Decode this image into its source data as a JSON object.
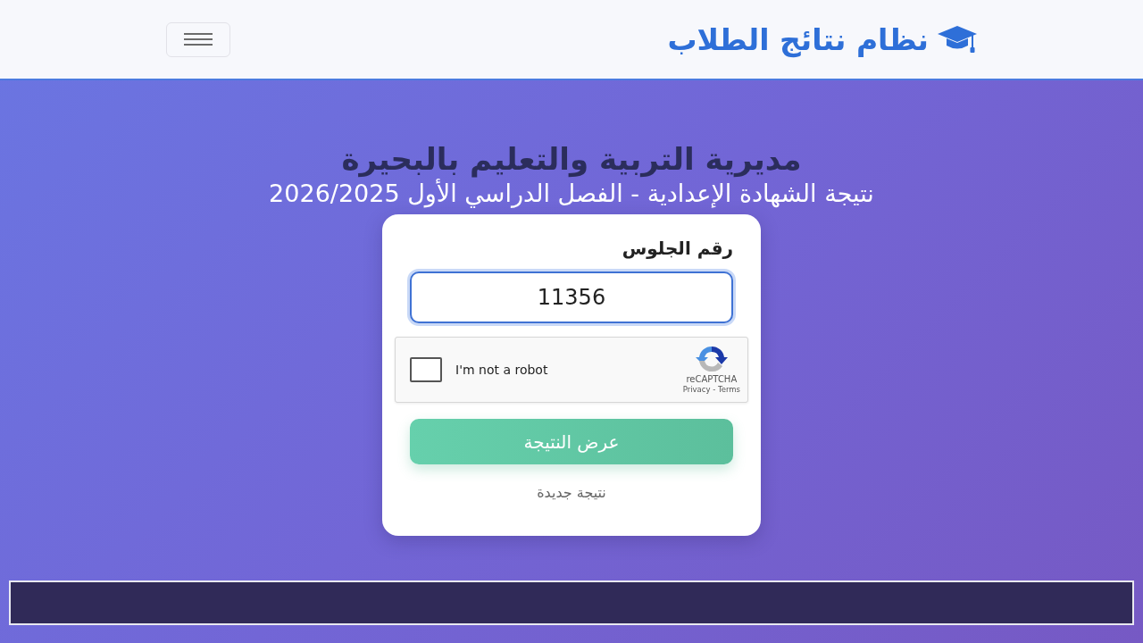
{
  "header": {
    "brand": "نظام نتائج الطلاب"
  },
  "hero": {
    "title": "مديرية التربية والتعليم بالبحيرة",
    "subtitle": "نتيجة الشهادة الإعدادية - الفصل الدراسي الأول 2026/2025"
  },
  "form": {
    "field": {
      "label": "رقم الجلوس",
      "value": "11356",
      "focused": true
    },
    "captcha": {
      "label": "I'm not a robot",
      "checked": false,
      "brand": "reCAPTCHA",
      "links": "Privacy - Terms"
    },
    "submit_button": "عرض النتيجة",
    "new_result_link": "نتيجة جديدة"
  }
}
